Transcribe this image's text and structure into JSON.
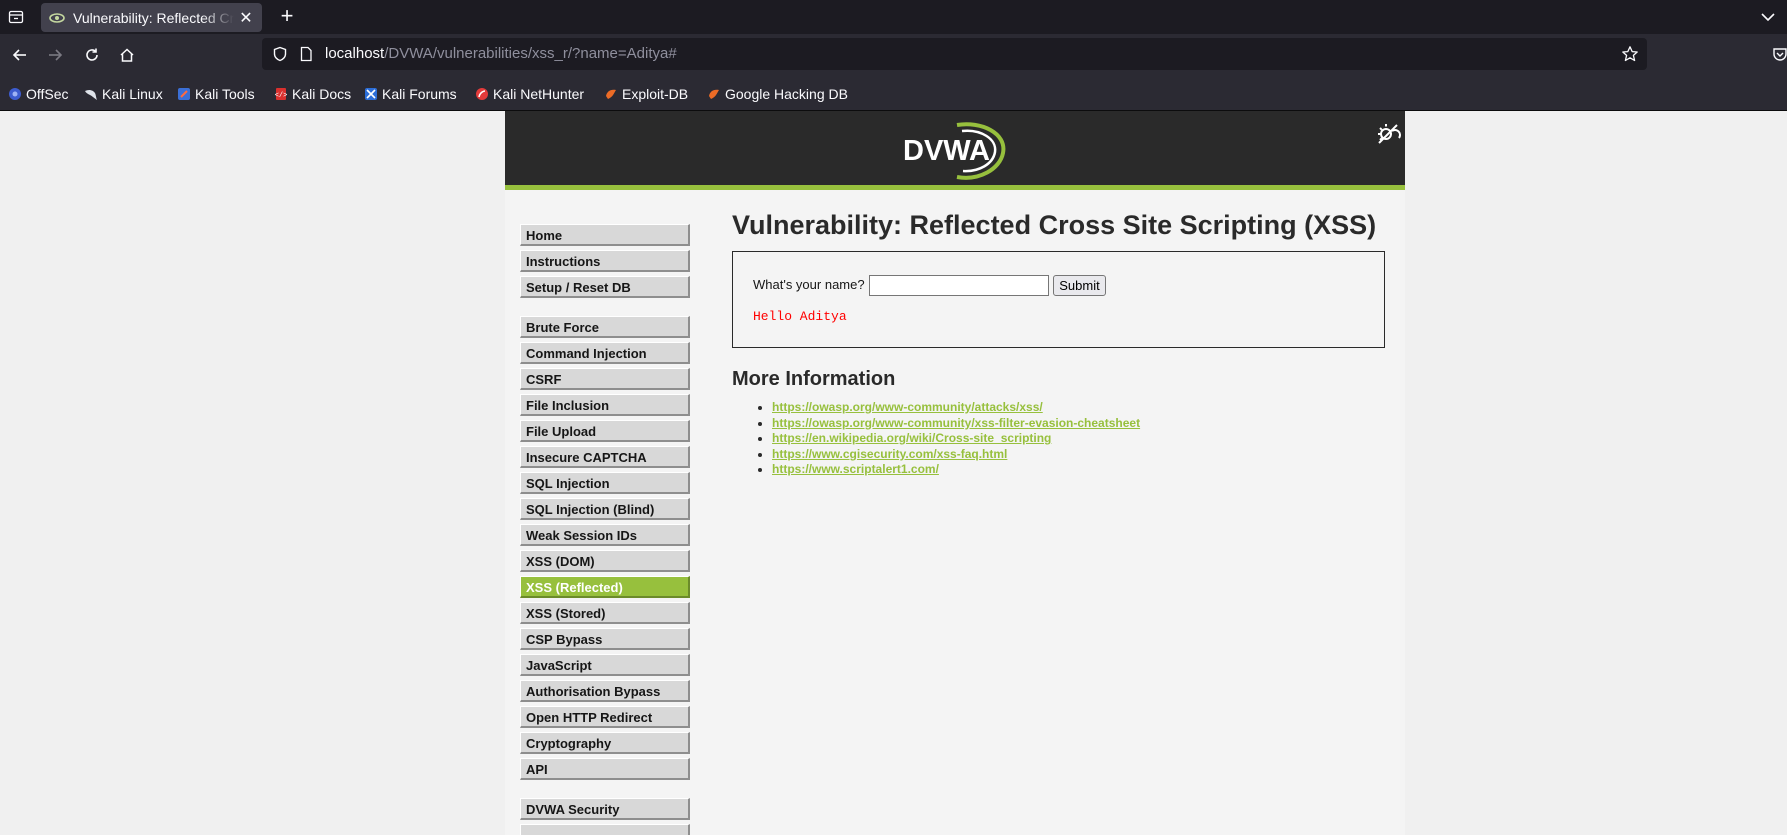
{
  "browser": {
    "tab": {
      "title": "Vulnerability: Reflected Cross Site Scripting (XSS) :: Damn Vulnerable Web Application (DVWA)",
      "close_label": "✕"
    },
    "new_tab_label": "+",
    "url": {
      "host": "localhost",
      "path": "/DVWA/vulnerabilities/xss_r/?name=Aditya#"
    },
    "bookmarks": [
      {
        "label": "OffSec",
        "icon": "offsec-icon"
      },
      {
        "label": "Kali Linux",
        "icon": "kali-dragon-icon"
      },
      {
        "label": "Kali Tools",
        "icon": "kali-tools-icon"
      },
      {
        "label": "Kali Docs",
        "icon": "kali-docs-icon"
      },
      {
        "label": "Kali Forums",
        "icon": "kali-forums-icon"
      },
      {
        "label": "Kali NetHunter",
        "icon": "nethunter-icon"
      },
      {
        "label": "Exploit-DB",
        "icon": "exploit-db-icon"
      },
      {
        "label": "Google Hacking DB",
        "icon": "ghdb-icon"
      }
    ]
  },
  "dvwa": {
    "logo_text": "DVWA",
    "menu": {
      "group1": [
        "Home",
        "Instructions",
        "Setup / Reset DB"
      ],
      "group2": [
        "Brute Force",
        "Command Injection",
        "CSRF",
        "File Inclusion",
        "File Upload",
        "Insecure CAPTCHA",
        "SQL Injection",
        "SQL Injection (Blind)",
        "Weak Session IDs",
        "XSS (DOM)",
        "XSS (Reflected)",
        "XSS (Stored)",
        "CSP Bypass",
        "JavaScript",
        "Authorisation Bypass",
        "Open HTTP Redirect",
        "Cryptography",
        "API"
      ],
      "group3": [
        "DVWA Security"
      ],
      "selected": "XSS (Reflected)"
    },
    "page_title": "Vulnerability: Reflected Cross Site Scripting (XSS)",
    "form": {
      "label": "What's your name?",
      "input_value": "",
      "submit_label": "Submit",
      "result": "Hello Aditya"
    },
    "more_info_title": "More Information",
    "links": [
      "https://owasp.org/www-community/attacks/xss/",
      "https://owasp.org/www-community/xss-filter-evasion-cheatsheet",
      "https://en.wikipedia.org/wiki/Cross-site_scripting",
      "https://www.cgisecurity.com/xss-faq.html",
      "https://www.scriptalert1.com/"
    ]
  },
  "colors": {
    "accent": "#97c03d",
    "header_bg": "#2a2a2a",
    "result_text": "#ff0000"
  }
}
